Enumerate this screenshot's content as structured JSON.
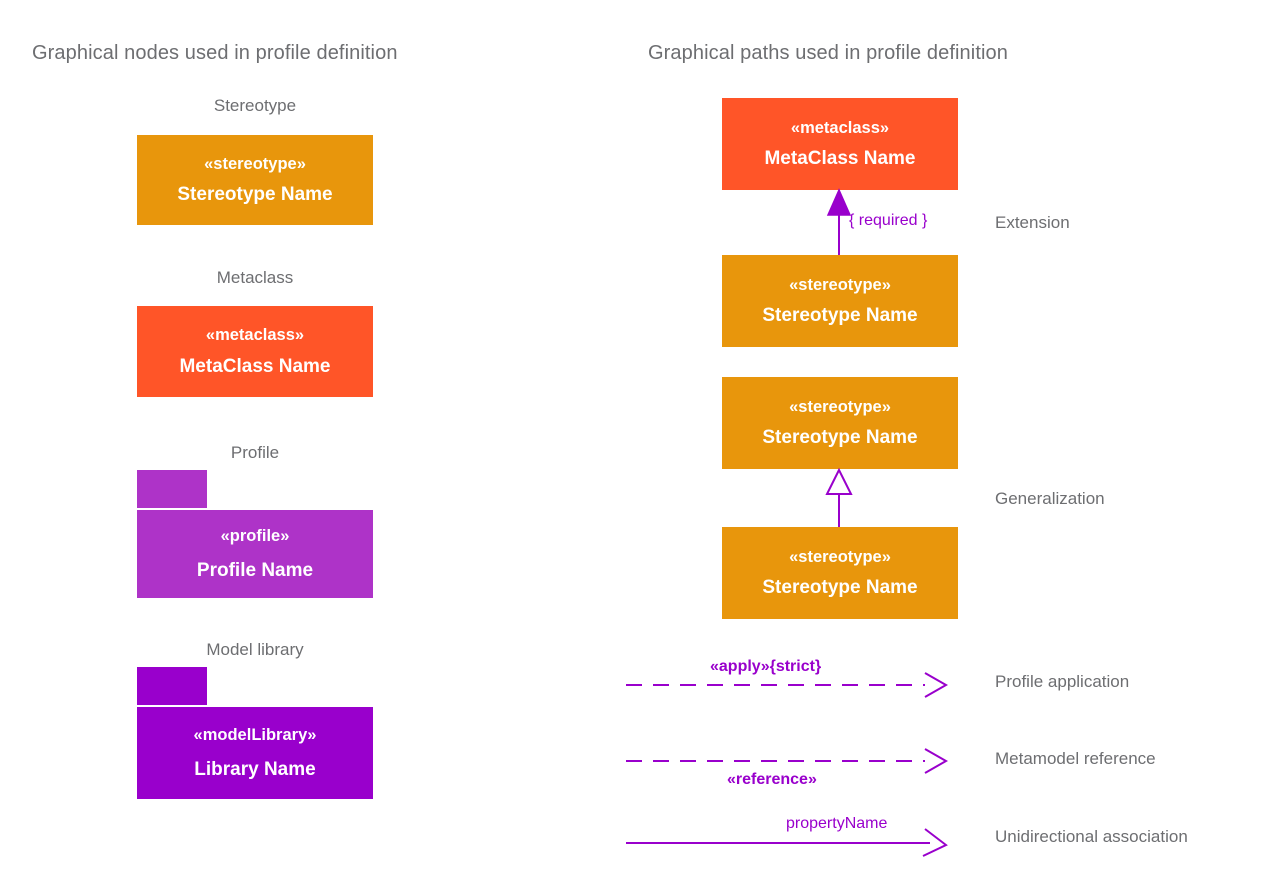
{
  "headings": {
    "nodes": "Graphical nodes used in profile definition",
    "paths": "Graphical paths used in profile definition"
  },
  "colors": {
    "stereotype_fill": "#E8960C",
    "metaclass_fill": "#FF5528",
    "profile_fill": "#AE33C8",
    "model_library_fill": "#9900CC",
    "path_stroke": "#9900CC",
    "text_gray": "#6D6E71",
    "box_text": "#FFFFFF",
    "background": "#FFFFFF"
  },
  "nodes": [
    {
      "caption": "Stereotype",
      "kind": "class-box",
      "keyword": "«stereotype»",
      "name": "Stereotype Name",
      "fill": "#E8960C"
    },
    {
      "caption": "Metaclass",
      "kind": "class-box",
      "keyword": "«metaclass»",
      "name": "MetaClass Name",
      "fill": "#FF5528"
    },
    {
      "caption": "Profile",
      "kind": "package",
      "keyword": "«profile»",
      "name": "Profile Name",
      "fill": "#AE33C8"
    },
    {
      "caption": "Model library",
      "kind": "package",
      "keyword": "«modelLibrary»",
      "name": "Library Name",
      "fill": "#9900CC"
    }
  ],
  "paths": [
    {
      "label": "Extension",
      "notation": "solid line with filled triangle arrowhead",
      "constraint": "{ required }",
      "target": {
        "keyword": "«metaclass»",
        "name": "MetaClass Name",
        "fill": "#FF5528"
      },
      "source": {
        "keyword": "«stereotype»",
        "name": "Stereotype Name",
        "fill": "#E8960C"
      }
    },
    {
      "label": "Generalization",
      "notation": "solid line with hollow triangle arrowhead",
      "target": {
        "keyword": "«stereotype»",
        "name": "Stereotype Name",
        "fill": "#E8960C"
      },
      "source": {
        "keyword": "«stereotype»",
        "name": "Stereotype Name",
        "fill": "#E8960C"
      }
    },
    {
      "label": "Profile application",
      "notation": "dashed line with open arrowhead",
      "edge_text": "«apply»{strict}",
      "edge_text_position": "above"
    },
    {
      "label": "Metamodel reference",
      "notation": "dashed line with open arrowhead",
      "edge_text": "«reference»",
      "edge_text_position": "below"
    },
    {
      "label": "Unidirectional association",
      "notation": "solid line with open arrowhead",
      "edge_text": "propertyName",
      "edge_text_position": "above"
    }
  ]
}
